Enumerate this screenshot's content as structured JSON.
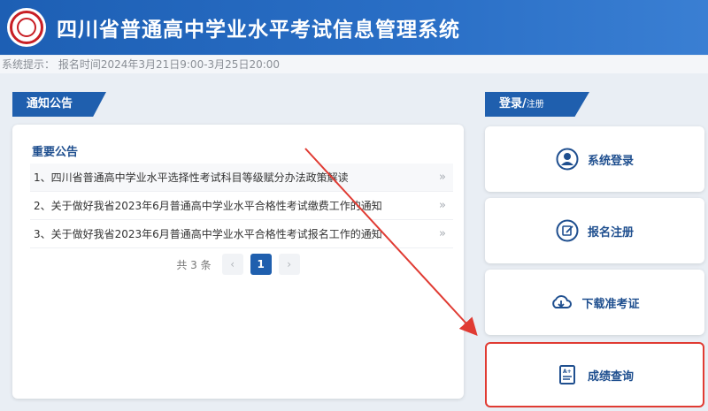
{
  "header": {
    "title": "四川省普通高中学业水平考试信息管理系统",
    "logo_icon": "emblem-icon",
    "bg_color": "#1d5fb4"
  },
  "notice_bar": {
    "text": "系统提示：  报名时间2024年3月21日9:00-3月25日20:00"
  },
  "announcements": {
    "tab_label": "通知公告",
    "section_title": "重要公告",
    "items": [
      "1、四川省普通高中学业水平选择性考试科目等级赋分办法政策解读",
      "2、关于做好我省2023年6月普通高中学业水平合格性考试缴费工作的通知",
      "3、关于做好我省2023年6月普通高中学业水平合格性考试报名工作的通知"
    ],
    "item_chevron": "»",
    "pager": {
      "total": "共 3 条",
      "prev": "‹",
      "current": "1",
      "next": "›"
    }
  },
  "login_panel": {
    "tab_main": "登录/",
    "tab_sub": "注册",
    "buttons": [
      {
        "label": "系统登录",
        "icon": "user-icon"
      },
      {
        "label": "报名注册",
        "icon": "edit-icon"
      },
      {
        "label": "下载准考证",
        "icon": "cloud-download-icon"
      },
      {
        "label": "成绩查询",
        "icon": "report-icon"
      }
    ],
    "highlight_color": "#e03b33"
  }
}
